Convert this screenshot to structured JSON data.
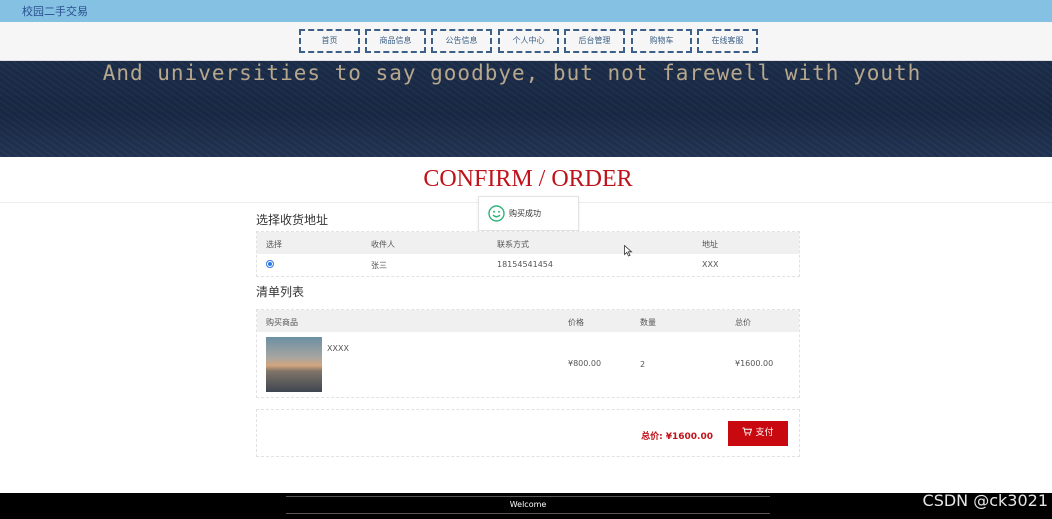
{
  "header": {
    "brand": "校园二手交易"
  },
  "nav": {
    "items": [
      "首页",
      "商品信息",
      "公告信息",
      "个人中心",
      "后台管理",
      "购物车",
      "在线客服"
    ]
  },
  "banner": {
    "slogan": "And universities to say goodbye, but not farewell with youth"
  },
  "page": {
    "title": "CONFIRM / ORDER"
  },
  "toast": {
    "icon": "smile-icon",
    "message": "购买成功"
  },
  "address": {
    "section_title": "选择收货地址",
    "columns": [
      "选择",
      "收件人",
      "联系方式",
      "地址"
    ],
    "rows": [
      {
        "selected": true,
        "name": "张三",
        "phone": "18154541454",
        "address": "XXX"
      }
    ]
  },
  "order_list": {
    "section_title": "清单列表",
    "columns": [
      "购买商品",
      "价格",
      "数量",
      "总价"
    ],
    "items": [
      {
        "name": "XXXX",
        "price": "¥800.00",
        "quantity": "2",
        "total": "¥1600.00"
      }
    ]
  },
  "summary": {
    "total_label": "总价:",
    "total_value": "¥1600.00",
    "pay_label": "支付",
    "pay_icon": "cart-icon"
  },
  "footer": {
    "text": "Welcome"
  },
  "watermark": "CSDN @ck3021",
  "colors": {
    "accent": "#c0121a",
    "pay_button": "#c8090f",
    "topbar": "#85c1e3",
    "nav_border": "#3b5f86"
  }
}
